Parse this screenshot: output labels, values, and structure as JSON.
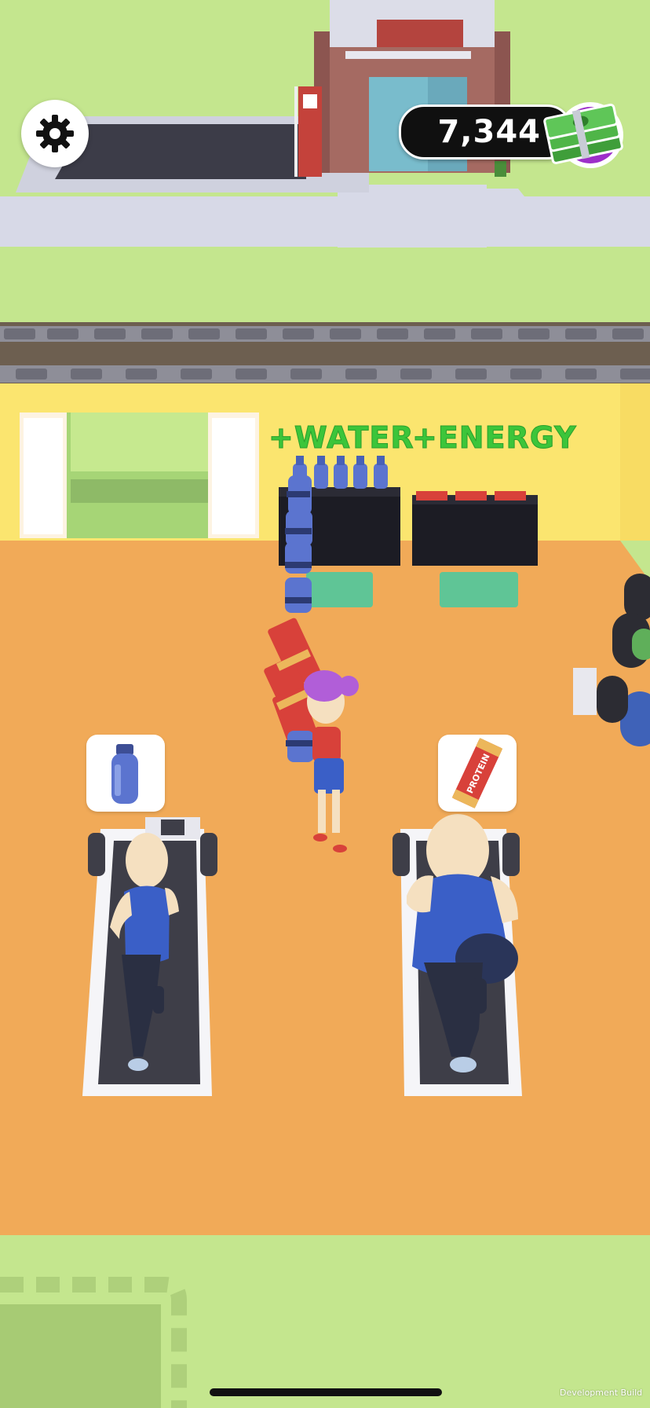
{
  "hud": {
    "settings_icon": "gear-icon",
    "cash_amount": "7,344",
    "cash_icon": "money-stack-icon"
  },
  "station_labels": {
    "water": "+WATER",
    "energy": "+ENERGY"
  },
  "bar_label": "PROTEIN",
  "requests": {
    "left_customer": "water-bottle-icon",
    "right_customer": "protein-bar-icon"
  },
  "footer": {
    "build_label": "Development Build"
  },
  "colors": {
    "grass": "#c4e68e",
    "floor": "#f1aa58",
    "wall": "#fbe56f",
    "label_green": "#3cc53a",
    "bottle_blue": "#5b74cf",
    "bar_red": "#d8413a"
  }
}
